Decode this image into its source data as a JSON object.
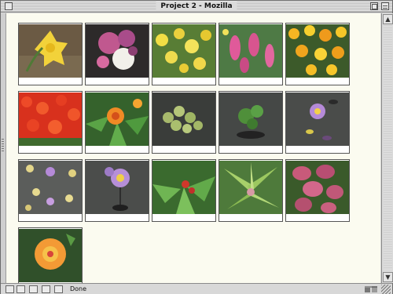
{
  "window": {
    "title": "Project 2 - Mozilla"
  },
  "status": {
    "text": "Done"
  },
  "gallery": {
    "thumbnails": [
      {
        "subject": "yellow daffodil"
      },
      {
        "subject": "pink and white chrysanthemums"
      },
      {
        "subject": "yellow daffodils bed"
      },
      {
        "subject": "pink hyacinths"
      },
      {
        "subject": "orange and yellow tulips"
      },
      {
        "subject": "red tulip field"
      },
      {
        "subject": "orange flower with green leaves"
      },
      {
        "subject": "lily pads on water"
      },
      {
        "subject": "water lily leaves"
      },
      {
        "subject": "purple water lily"
      },
      {
        "subject": "pond lily pads with blossoms"
      },
      {
        "subject": "purple water lilies"
      },
      {
        "subject": "green plant with red buds"
      },
      {
        "subject": "spiky green bromeliad"
      },
      {
        "subject": "pink coleus leaves"
      },
      {
        "subject": "orange hibiscus"
      }
    ]
  },
  "colors": {
    "page_background": "#fbfbf0",
    "chrome": "#d6d6d6"
  }
}
